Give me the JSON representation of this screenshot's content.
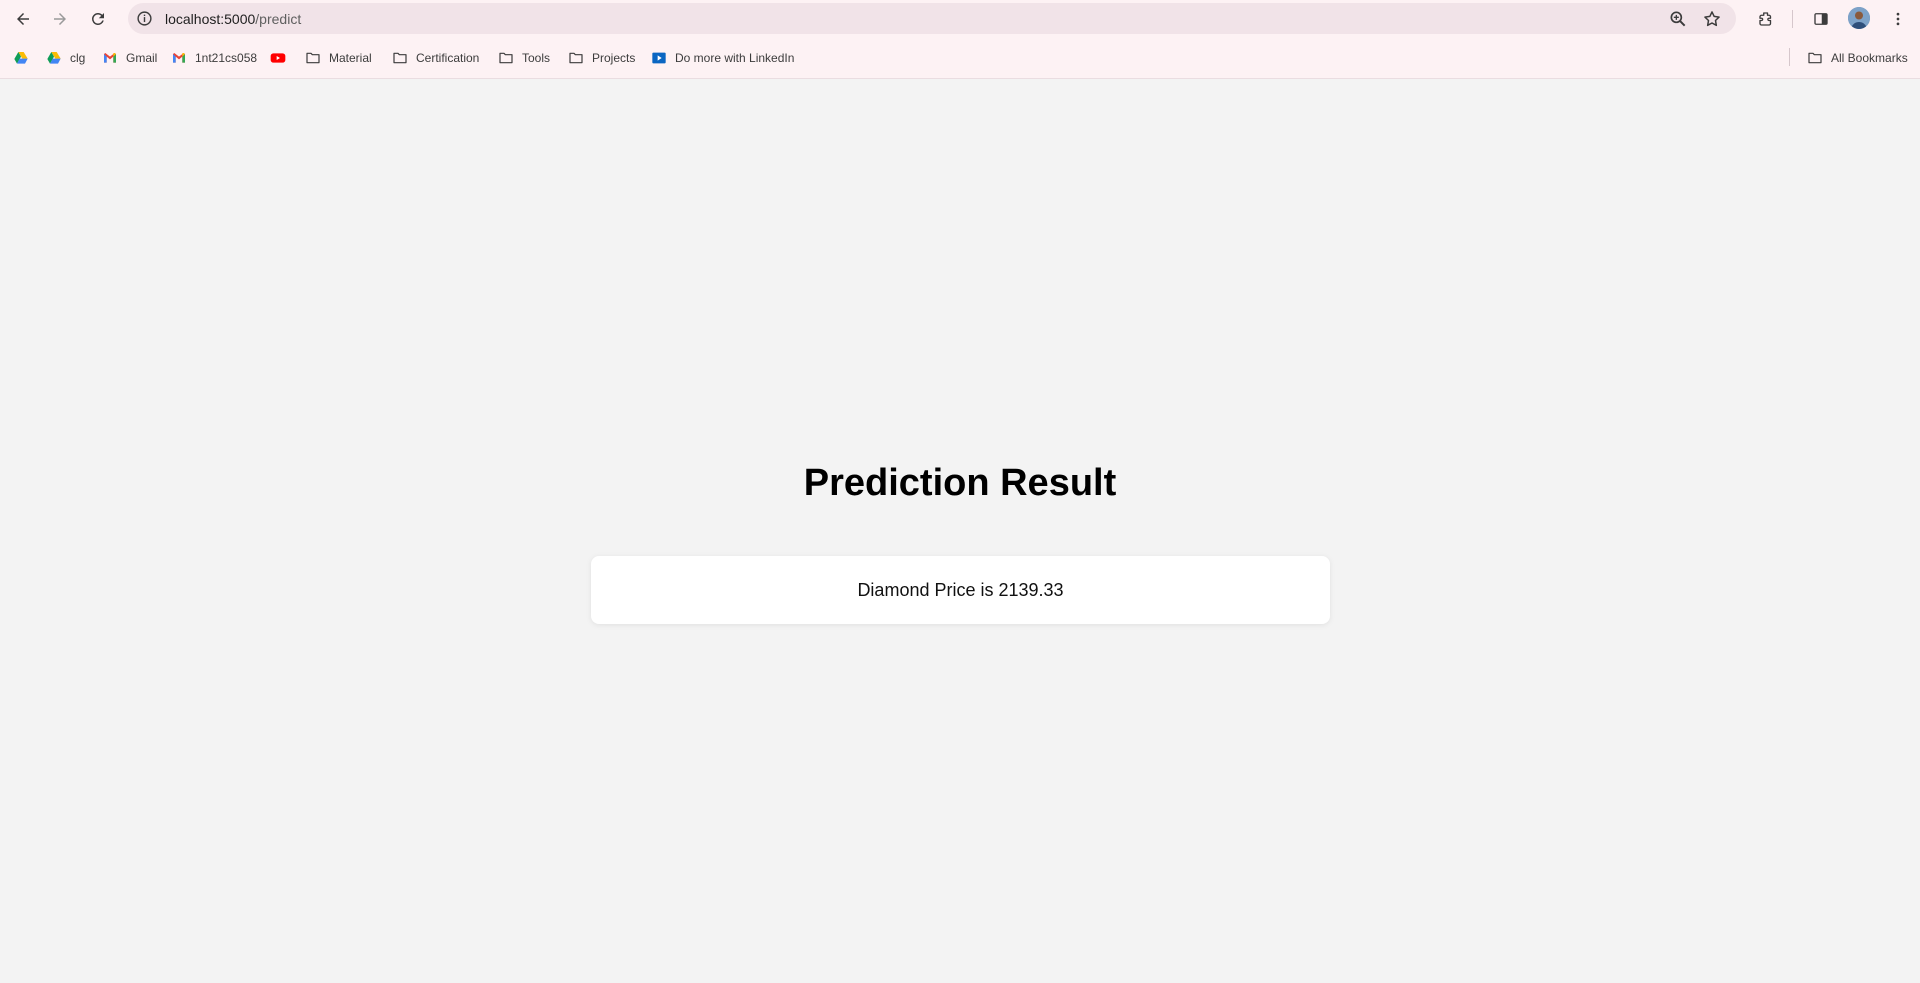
{
  "browser": {
    "url_host": "localhost:5000",
    "url_path": "/predict"
  },
  "bookmarks": {
    "items": [
      {
        "label": "",
        "icon": "google-drive-icon"
      },
      {
        "label": "clg",
        "icon": "google-drive-icon"
      },
      {
        "label": "Gmail",
        "icon": "gmail-icon"
      },
      {
        "label": "1nt21cs058",
        "icon": "gmail-icon"
      },
      {
        "label": "",
        "icon": "youtube-icon"
      },
      {
        "label": "Material",
        "icon": "folder-icon"
      },
      {
        "label": "Certification",
        "icon": "folder-icon"
      },
      {
        "label": "Tools",
        "icon": "folder-icon"
      },
      {
        "label": "Projects",
        "icon": "folder-icon"
      },
      {
        "label": "Do more with LinkedIn",
        "icon": "linkedin-learning-icon"
      }
    ],
    "all_bookmarks_label": "All Bookmarks"
  },
  "page": {
    "title": "Prediction Result",
    "result_text": "Diamond Price is 2139.33"
  },
  "colors": {
    "page_background": "#f3f3f3",
    "card_background": "#ffffff",
    "toolbar_background": "#fdf2f4"
  }
}
